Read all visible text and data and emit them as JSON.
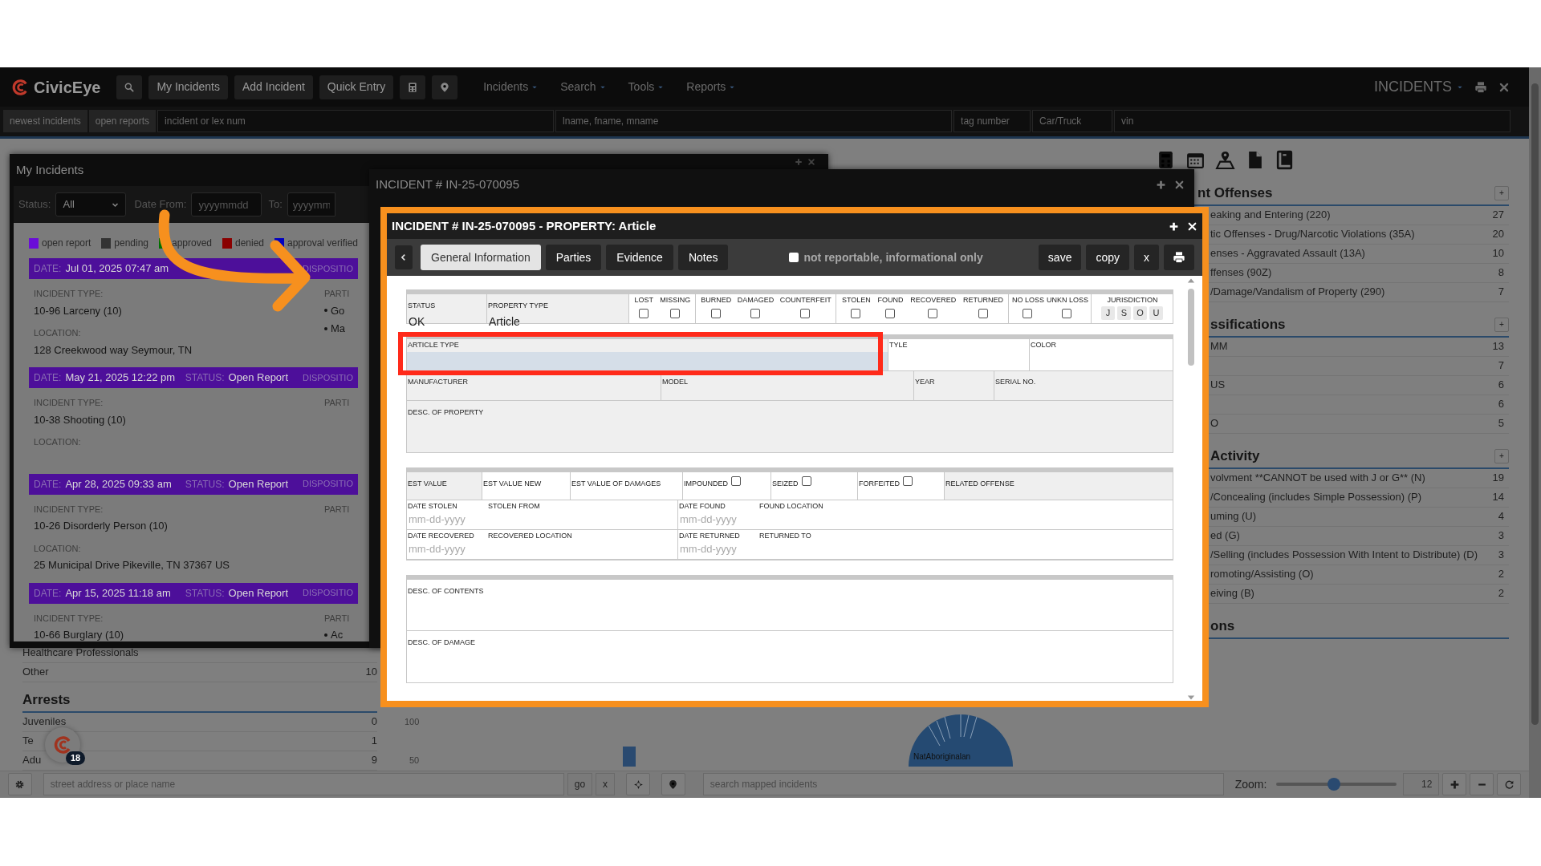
{
  "nav": {
    "logo": "CivicEye",
    "buttons": [
      "My Incidents",
      "Add Incident",
      "Quick Entry"
    ],
    "menus": [
      "Incidents",
      "Search",
      "Tools",
      "Reports"
    ],
    "module": "INCIDENTS"
  },
  "quick_search": {
    "buttons": [
      "newest incidents",
      "open reports"
    ],
    "fields": [
      {
        "placeholder": "incident or lex num"
      },
      {
        "placeholder": "lname, fname, mname"
      },
      {
        "placeholder": "tag number"
      },
      {
        "placeholder": "Car/Truck"
      },
      {
        "placeholder": "vin"
      }
    ]
  },
  "dashboard": {
    "left_rows": [
      {
        "label": "Healthcare Professionals"
      },
      {
        "label": "Other",
        "count": "10"
      }
    ],
    "arrests": {
      "title": "Arrests",
      "rows": [
        {
          "label": "Juveniles",
          "count": "0"
        },
        {
          "label": "Te",
          "count": "1"
        },
        {
          "label": "Adu",
          "count": "9"
        }
      ]
    },
    "chart": {
      "ticks": [
        "100",
        "50"
      ],
      "pie_label": "NatAboriginalan"
    },
    "notification_count": "18",
    "sections": [
      {
        "title": "nt Offenses",
        "add": "+",
        "rows": [
          {
            "label": "eaking and Entering (220)",
            "count": "27"
          },
          {
            "label": "tic Offenses - Drug/Narcotic Violations (35A)",
            "count": "20"
          },
          {
            "label": "enses - Aggravated Assault (13A)",
            "count": "10"
          },
          {
            "label": "ffenses (90Z)",
            "count": "8"
          },
          {
            "label": "/Damage/Vandalism of Property (290)",
            "count": "7"
          }
        ]
      },
      {
        "title": "ssifications",
        "add": "+",
        "rows": [
          {
            "label": "MM",
            "count": "13"
          },
          {
            "count": "7"
          },
          {
            "label": "US",
            "count": "6"
          },
          {
            "count": "6"
          },
          {
            "label": "O",
            "count": "5"
          }
        ]
      },
      {
        "title": "Activity",
        "add": "+",
        "rows": [
          {
            "label": "volvment **CANNOT be used with J or G** (N)",
            "count": "19"
          },
          {
            "label": "/Concealing (includes Simple Possession) (P)",
            "count": "14"
          },
          {
            "label": "uming (U)",
            "count": "4"
          },
          {
            "label": "ed (G)",
            "count": "3"
          },
          {
            "label": "/Selling (includes Possession With Intent to Distribute) (D)",
            "count": "3"
          },
          {
            "label": "romoting/Assisting (O)",
            "count": "2"
          },
          {
            "label": "eiving (B)",
            "count": "2"
          }
        ]
      },
      {
        "title": "ons"
      }
    ]
  },
  "my_incidents": {
    "title": "My Incidents",
    "status_label": "Status:",
    "status_value": "All",
    "from_label": "Date From:",
    "from_placeholder": "yyyymmdd",
    "to_label": "To:",
    "to_placeholder": "yyyymm",
    "legend": [
      {
        "label": "open report",
        "color": "#6a0dd8"
      },
      {
        "label": "pending",
        "color": "#333333"
      },
      {
        "label": "approved",
        "color": "#007000"
      },
      {
        "label": "denied",
        "color": "#8a0000"
      },
      {
        "label": "approval verified",
        "color": "#0000c0"
      }
    ],
    "incidents": [
      {
        "date_label": "DATE:",
        "date": "Jul 01, 2025 07:47 am",
        "disposition_label": "DISPOSITIO",
        "type_label": "INCIDENT TYPE:",
        "type": "10-96 Larceny (10)",
        "location_label": "LOCATION:",
        "location": "128 Creekwood way Seymour, TN",
        "parties_label": "PARTI",
        "parties": [
          "Go",
          "Ma"
        ]
      },
      {
        "date_label": "DATE:",
        "date": "May 21, 2025 12:22 pm",
        "status_label": "STATUS:",
        "status": "Open Report",
        "disposition_label": "DISPOSITIO",
        "type_label": "INCIDENT TYPE:",
        "type": "10-38 Shooting (10)",
        "location_label": "LOCATION:",
        "parties_label": "PARTI"
      },
      {
        "date_label": "DATE:",
        "date": "Apr 28, 2025 09:33 am",
        "status_label": "STATUS:",
        "status": "Open Report",
        "disposition_label": "DISPOSITIO",
        "type_label": "INCIDENT TYPE:",
        "type": "10-26 Disorderly Person (10)",
        "location_label": "LOCATION:",
        "location": "25 Municipal Drive Pikeville, TN 37367 US",
        "parties_label": "PARTI"
      },
      {
        "date_label": "DATE:",
        "date": "Apr 15, 2025 11:18 am",
        "status_label": "STATUS:",
        "status": "Open Report",
        "disposition_label": "DISPOSITIO",
        "type_label": "INCIDENT TYPE:",
        "type": "10-66 Burglary (10)",
        "parties_label": "PARTI",
        "parties": [
          "Ac"
        ]
      }
    ]
  },
  "incident_window": {
    "title": "INCIDENT # IN-25-070095"
  },
  "property": {
    "title": "INCIDENT # IN-25-070095 - PROPERTY: Article",
    "tabs": [
      {
        "label": "General Information",
        "selected": true
      },
      {
        "label": "Parties",
        "selected": false
      },
      {
        "label": "Evidence",
        "selected": false
      },
      {
        "label": "Notes",
        "selected": false
      }
    ],
    "not_reportable": {
      "label": "not reportable, informational only",
      "checked": false
    },
    "buttons": [
      "save",
      "copy",
      "x"
    ],
    "status": {
      "label": "STATUS",
      "value": "OK"
    },
    "property_type": {
      "label": "PROPERTY TYPE",
      "value": "Article"
    },
    "flag_groups": [
      [
        {
          "label": "LOST",
          "checked": false
        },
        {
          "label": "MISSING",
          "checked": false
        }
      ],
      [
        {
          "label": "BURNED",
          "checked": false
        },
        {
          "label": "DAMAGED",
          "checked": false
        },
        {
          "label": "COUNTERFEIT",
          "checked": false
        }
      ],
      [
        {
          "label": "STOLEN",
          "checked": false
        },
        {
          "label": "FOUND",
          "checked": false
        },
        {
          "label": "RECOVERED",
          "checked": false
        },
        {
          "label": "RETURNED",
          "checked": false
        }
      ],
      [
        {
          "label": "NO LOSS",
          "checked": false
        },
        {
          "label": "UNKN LOSS",
          "checked": false
        }
      ]
    ],
    "jurisdiction": {
      "label": "JURISDICTION",
      "options": [
        {
          "label": "J",
          "selected": false
        },
        {
          "label": "S",
          "selected": false
        },
        {
          "label": "O",
          "selected": false
        },
        {
          "label": "U",
          "selected": false
        }
      ]
    },
    "article_row": [
      {
        "label": "ARTICLE TYPE",
        "focused": true
      },
      {
        "label": "TYLE",
        "focused": false
      },
      {
        "label": "COLOR",
        "focused": false
      }
    ],
    "make_row": [
      "MANUFACTURER",
      "MODEL",
      "YEAR",
      "SERIAL NO."
    ],
    "desc_property": "DESC. OF PROPERTY",
    "value_row": [
      {
        "label": "EST VALUE",
        "kind": "text"
      },
      {
        "label": "EST VALUE NEW",
        "kind": "text"
      },
      {
        "label": "EST VALUE OF DAMAGES",
        "kind": "text"
      },
      {
        "label": "IMPOUNDED",
        "kind": "check",
        "checked": false
      },
      {
        "label": "SEIZED",
        "kind": "check",
        "checked": false
      },
      {
        "label": "FORFEITED",
        "kind": "check",
        "checked": false
      },
      {
        "label": "RELATED OFFENSE",
        "kind": "text"
      }
    ],
    "date_rows": [
      [
        {
          "label": "DATE STOLEN",
          "placeholder": "mm-dd-yyyy",
          "place_label": "STOLEN FROM"
        },
        {
          "label": "DATE FOUND",
          "placeholder": "mm-dd-yyyy",
          "place_label": "FOUND LOCATION"
        }
      ],
      [
        {
          "label": "DATE RECOVERED",
          "placeholder": "mm-dd-yyyy",
          "place_label": "RECOVERED LOCATION"
        },
        {
          "label": "DATE RETURNED",
          "placeholder": "mm-dd-yyyy",
          "place_label": "RETURNED TO"
        }
      ]
    ],
    "desc_rows": [
      "DESC. OF CONTENTS",
      "DESC. OF DAMAGE"
    ]
  },
  "bottom_bar": {
    "address_placeholder": "street address or place name",
    "go": "go",
    "clear": "x",
    "map_search_placeholder": "search mapped incidents",
    "zoom_label": "Zoom:",
    "zoom": {
      "level": 0.48
    },
    "zoom_value": "12"
  }
}
